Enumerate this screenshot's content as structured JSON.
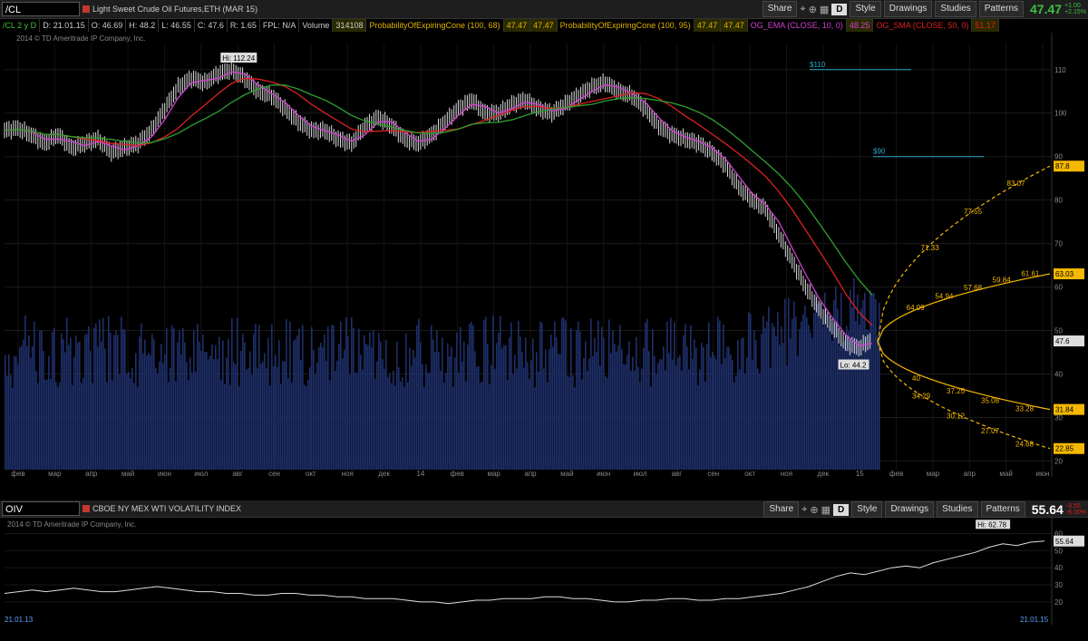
{
  "top_toolbar": {
    "symbol": "/CL",
    "description": "Light Sweet Crude Oil Futures,ETH (MAR 15)",
    "buttons": [
      "Share",
      "D",
      "Style",
      "Drawings",
      "Studies",
      "Patterns"
    ],
    "last": "47.47",
    "change": "+1.00",
    "change_pct": "+2.15%"
  },
  "info_bar": {
    "title": "/CL 2 y D",
    "date": "D: 21.01.15",
    "open": "O: 46.69",
    "high": "H: 48.2",
    "low": "L: 46.55",
    "close": "C: 47.6",
    "range": "R: 1.65",
    "fpl": "FPL: N/A",
    "volume_label": "Volume",
    "volume": "314108",
    "cone1": "ProbabilityOfExpiringCone (100, 68)",
    "cone1_v1": "47.47",
    "cone1_v2": "47.47",
    "cone2": "ProbabilityOfExpiringCone (100, 95)",
    "cone2_v1": "47.47",
    "cone2_v2": "47.47",
    "ema": "OG_EMA (CLOSE, 10, 0)",
    "ema_val": "48.25",
    "sma": "OG_SMA (CLOSE, 50, 0)",
    "sma_val": "51.17"
  },
  "copyright": "2014 © TD Ameritrade IP Company, Inc.",
  "chart_data": [
    {
      "type": "line",
      "title": "/CL 2 y D",
      "ylim": [
        20,
        115
      ],
      "y_ticks": [
        20,
        30,
        40,
        50,
        60,
        70,
        80,
        90,
        100,
        110
      ],
      "x_ticks": [
        "фев",
        "мар",
        "апр",
        "май",
        "июн",
        "июл",
        "авг",
        "сен",
        "окт",
        "ноя",
        "дек",
        "14",
        "фев",
        "мар",
        "апр",
        "май",
        "июн",
        "июл",
        "авг",
        "сен",
        "окт",
        "ноя",
        "дек",
        "15",
        "фев",
        "мар",
        "апр",
        "май",
        "июн"
      ],
      "price_path": [
        [
          0,
          96
        ],
        [
          3,
          96.5
        ],
        [
          6,
          95
        ],
        [
          9,
          93
        ],
        [
          12,
          95
        ],
        [
          15,
          92
        ],
        [
          18,
          93
        ],
        [
          21,
          94
        ],
        [
          24,
          91
        ],
        [
          27,
          92
        ],
        [
          30,
          93
        ],
        [
          33,
          96
        ],
        [
          36,
          101
        ],
        [
          39,
          106
        ],
        [
          42,
          108
        ],
        [
          45,
          107
        ],
        [
          48,
          109
        ],
        [
          51,
          110
        ],
        [
          54,
          108
        ],
        [
          57,
          105
        ],
        [
          60,
          104
        ],
        [
          63,
          101
        ],
        [
          66,
          98
        ],
        [
          69,
          96
        ],
        [
          72,
          96
        ],
        [
          75,
          94
        ],
        [
          78,
          93
        ],
        [
          81,
          97
        ],
        [
          84,
          99
        ],
        [
          87,
          97
        ],
        [
          90,
          94
        ],
        [
          93,
          93
        ],
        [
          96,
          95
        ],
        [
          99,
          98
        ],
        [
          102,
          101
        ],
        [
          105,
          103
        ],
        [
          108,
          100
        ],
        [
          111,
          100
        ],
        [
          114,
          102
        ],
        [
          117,
          103
        ],
        [
          120,
          101
        ],
        [
          123,
          100
        ],
        [
          126,
          102
        ],
        [
          129,
          104
        ],
        [
          132,
          106
        ],
        [
          135,
          107
        ],
        [
          138,
          105
        ],
        [
          141,
          104
        ],
        [
          144,
          101
        ],
        [
          147,
          97
        ],
        [
          150,
          95
        ],
        [
          153,
          94
        ],
        [
          156,
          93
        ],
        [
          159,
          91
        ],
        [
          162,
          88
        ],
        [
          165,
          83
        ],
        [
          168,
          80
        ],
        [
          171,
          78
        ],
        [
          174,
          72
        ],
        [
          177,
          66
        ],
        [
          180,
          60
        ],
        [
          183,
          55
        ],
        [
          186,
          51
        ],
        [
          189,
          47
        ],
        [
          192,
          46
        ],
        [
          195,
          48
        ]
      ],
      "hi_label": "Hi: 112.24",
      "lo_label": "Lo: 44.2",
      "levels": [
        {
          "label": "$110",
          "value": 110
        },
        {
          "label": "$90",
          "value": 90
        }
      ],
      "cone_68_upper": [
        [
          "64.09",
          64.09
        ],
        [
          "54.94",
          54.94
        ],
        [
          "57.68",
          57.68
        ],
        [
          "59.84",
          59.84
        ],
        [
          "61.61",
          61.61
        ]
      ],
      "cone_68_lower": [
        [
          "40",
          40
        ],
        [
          "37.25",
          37.25
        ],
        [
          "35.08",
          35.08
        ],
        [
          "33.28",
          33.28
        ]
      ],
      "cone_95_upper": [
        [
          "71.33",
          71.33
        ],
        [
          "77.55",
          77.55
        ],
        [
          "83.07",
          83.07
        ]
      ],
      "cone_95_lower": [
        [
          "34.29",
          34.29
        ],
        [
          "30.12",
          30.12
        ],
        [
          "27.07",
          27.07
        ],
        [
          "24.68",
          24.68
        ]
      ],
      "right_labels": [
        {
          "text": "87.8",
          "color": "#f5b800"
        },
        {
          "text": "63.03",
          "color": "#f5b800"
        },
        {
          "text": "47.6",
          "color": "#ffffff"
        },
        {
          "text": "31.84",
          "color": "#f5b800"
        },
        {
          "text": "22.85",
          "color": "#f5b800"
        }
      ]
    },
    {
      "type": "line",
      "title": "CBOE NY MEX WTI VOLATILITY INDEX",
      "symbol": "OIV",
      "ylim": [
        12,
        64
      ],
      "y_ticks": [
        20,
        30,
        40,
        50,
        60
      ],
      "hi_label": "Hi: 62.78",
      "last": "55.64",
      "change": "-3.55",
      "change_pct": "-6.00%",
      "start_date": "21.01.13",
      "end_date": "21.01.15",
      "values": [
        25,
        26,
        27,
        26,
        27,
        28,
        27,
        26,
        26,
        27,
        28,
        29,
        28,
        27,
        26,
        26,
        25,
        25,
        24,
        24,
        25,
        25,
        24,
        24,
        23,
        23,
        22,
        22,
        22,
        21,
        20,
        20,
        19,
        20,
        21,
        21,
        22,
        22,
        22,
        23,
        23,
        22,
        22,
        21,
        20,
        20,
        21,
        21,
        22,
        22,
        21,
        21,
        22,
        22,
        23,
        24,
        25,
        27,
        29,
        32,
        35,
        37,
        36,
        38,
        40,
        41,
        40,
        43,
        45,
        47,
        49,
        52,
        54,
        53,
        55,
        55.64
      ]
    }
  ]
}
